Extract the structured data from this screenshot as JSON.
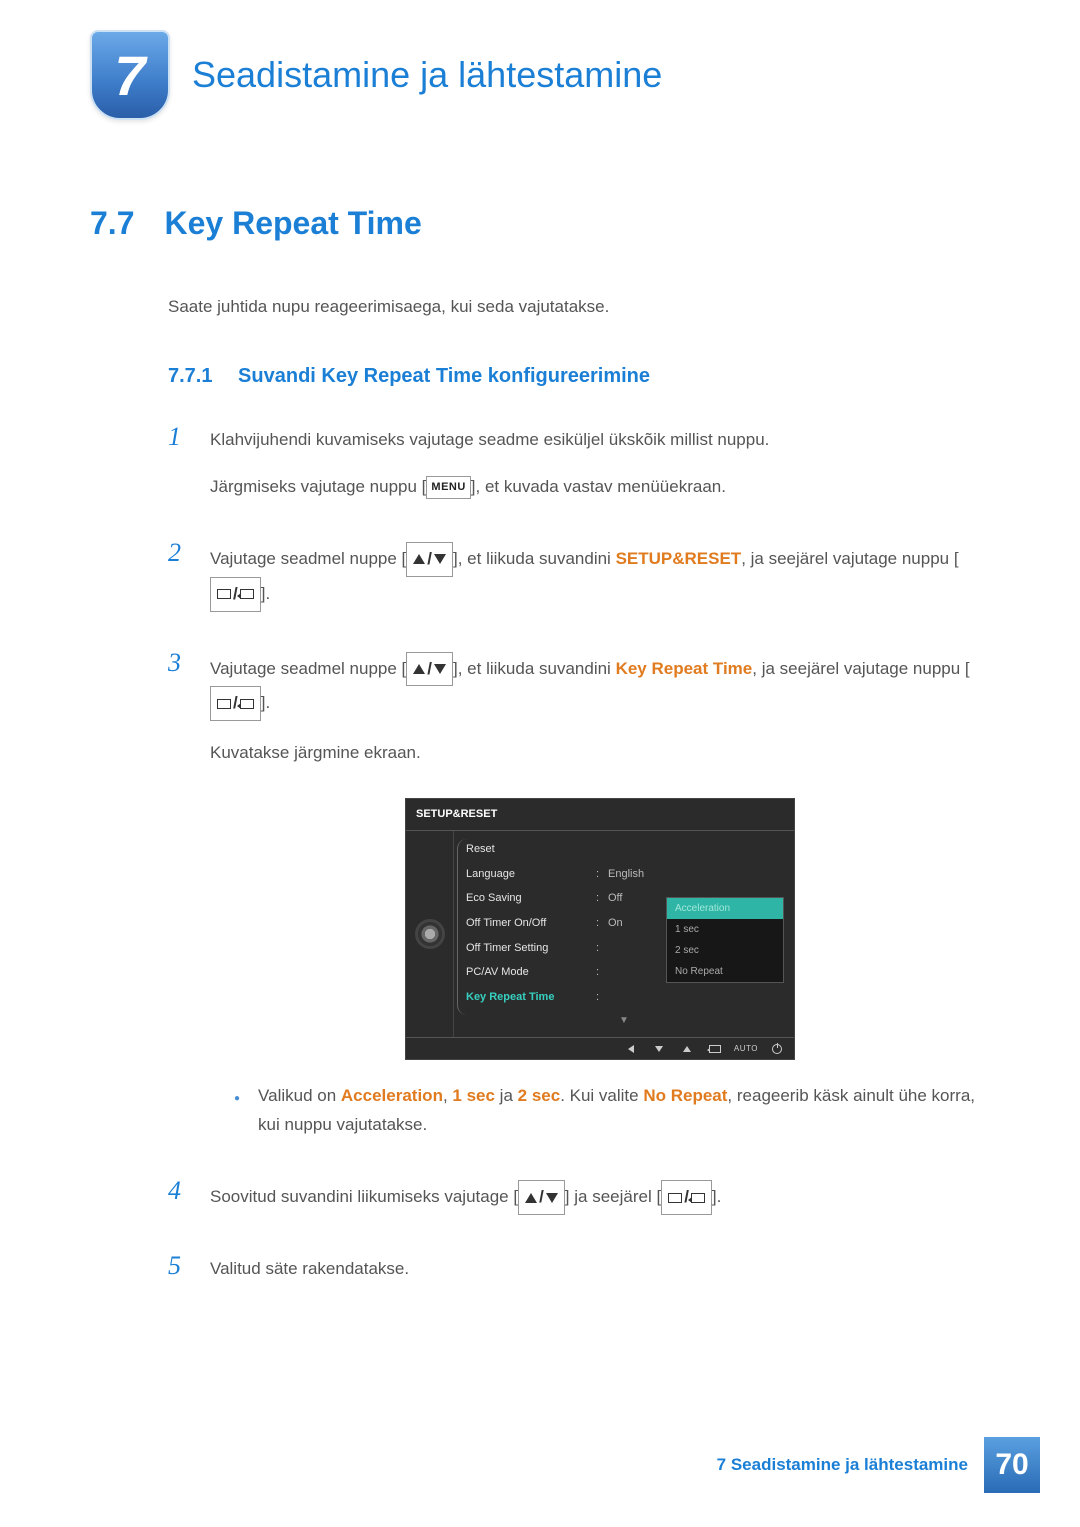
{
  "chapter": {
    "num": "7",
    "title": "Seadistamine ja lähtestamine"
  },
  "section": {
    "num": "7.7",
    "title": "Key Repeat Time"
  },
  "intro": "Saate juhtida nupu reageerimisaega, kui seda vajutatakse.",
  "subsection": {
    "num": "7.7.1",
    "title": "Suvandi Key Repeat Time konfigureerimine"
  },
  "steps": {
    "s1": {
      "num": "1",
      "p1": "Klahvijuhendi kuvamiseks vajutage seadme esiküljel ükskõik millist nuppu.",
      "p2a": "Järgmiseks vajutage nuppu [",
      "menu": "MENU",
      "p2b": "], et kuvada vastav menüüekraan."
    },
    "s2": {
      "num": "2",
      "p_before": "Vajutage seadmel nuppe [",
      "p_mid": "], et liikuda suvandini ",
      "hl": "SETUP&RESET",
      "p_after": ", ja seejärel vajutage nuppu [",
      "p_end": "]."
    },
    "s3": {
      "num": "3",
      "p_before": "Vajutage seadmel nuppe [",
      "p_mid": "], et liikuda suvandini ",
      "hl": "Key Repeat Time",
      "p_after": ", ja seejärel vajutage nuppu [",
      "p_end": "].",
      "p_tail": "Kuvatakse järgmine ekraan."
    },
    "bullet": {
      "t1": "Valikud on ",
      "o1": "Acceleration",
      "t2": ", ",
      "o2": "1 sec",
      "t3": " ja ",
      "o3": "2 sec",
      "t4": ". Kui valite ",
      "o4": "No Repeat",
      "t5": ", reageerib käsk ainult ühe korra, kui nuppu vajutatakse."
    },
    "s4": {
      "num": "4",
      "p_before": "Soovitud suvandini liikumiseks vajutage [",
      "p_mid": "] ja seejärel [",
      "p_end": "]."
    },
    "s5": {
      "num": "5",
      "text": "Valitud säte rakendatakse."
    }
  },
  "osd": {
    "title": "SETUP&RESET",
    "rows": {
      "reset": "Reset",
      "language": "Language",
      "language_v": "English",
      "eco": "Eco Saving",
      "eco_v": "Off",
      "offtimer": "Off Timer On/Off",
      "offtimer_v": "On",
      "offtimerset": "Off Timer Setting",
      "pcav": "PC/AV Mode",
      "krt": "Key Repeat Time"
    },
    "popup": {
      "o1": "Acceleration",
      "o2": "1 sec",
      "o3": "2 sec",
      "o4": "No Repeat"
    },
    "auto": "AUTO"
  },
  "footer": {
    "text": "7 Seadistamine ja lähtestamine",
    "page": "70"
  }
}
